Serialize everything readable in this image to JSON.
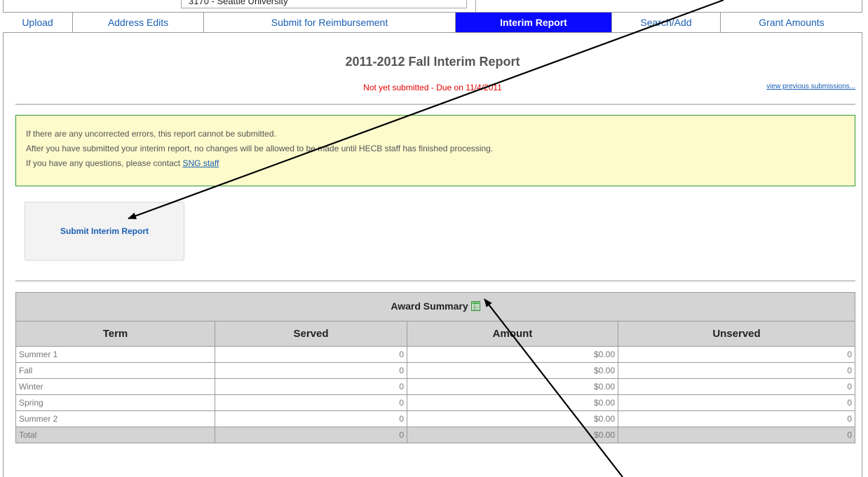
{
  "header": {
    "school_select_value": "3170 - Seattle University"
  },
  "tabs": [
    {
      "label": "Upload"
    },
    {
      "label": "Address Edits"
    },
    {
      "label": "Submit for Reimbursement"
    },
    {
      "label": "Interim Report"
    },
    {
      "label": "Search/Add"
    },
    {
      "label": "Grant Amounts"
    }
  ],
  "page": {
    "title": "2011-2012 Fall Interim Report",
    "status": "Not yet submitted - Due on 11/4/2011",
    "previous_link": "view previous submissions..."
  },
  "notice": {
    "line1": "If there are any uncorrected errors, this report cannot be submitted.",
    "line2": "After you have submitted your interim report, no changes will be allowed to be made until HECB staff has finished processing.",
    "line3_prefix": "If you have any questions, please contact ",
    "line3_link": "SNG staff"
  },
  "submit_button": "Submit Interim Report",
  "summary": {
    "caption": "Award Summary",
    "columns": [
      "Term",
      "Served",
      "Amount",
      "Unserved"
    ],
    "rows": [
      {
        "term": "Summer 1",
        "served": "0",
        "amount": "$0.00",
        "unserved": "0"
      },
      {
        "term": "Fall",
        "served": "0",
        "amount": "$0.00",
        "unserved": "0"
      },
      {
        "term": "Winter",
        "served": "0",
        "amount": "$0.00",
        "unserved": "0"
      },
      {
        "term": "Spring",
        "served": "0",
        "amount": "$0.00",
        "unserved": "0"
      },
      {
        "term": "Summer 2",
        "served": "0",
        "amount": "$0.00",
        "unserved": "0"
      }
    ],
    "total": {
      "term": "Total",
      "served": "0",
      "amount": "$0.00",
      "unserved": "0"
    }
  },
  "icons": {
    "export": "csv-export-icon",
    "annotation": "annotation-arrow"
  },
  "colors": {
    "active_tab": "#0a0aff",
    "link": "#1a5fb4",
    "status": "#e00000",
    "notice_bg": "#fdfacc",
    "notice_border": "#2e9a2e"
  }
}
